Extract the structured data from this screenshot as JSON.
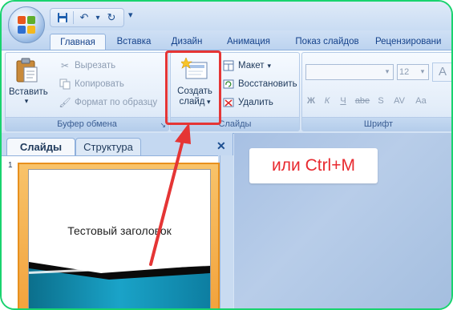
{
  "quick_access": {
    "items": [
      {
        "name": "save-icon",
        "glyph": "💾"
      },
      {
        "name": "undo-icon",
        "glyph": "↶"
      },
      {
        "name": "undo-dropdown-icon",
        "glyph": "▾"
      },
      {
        "name": "redo-icon",
        "glyph": "↻"
      },
      {
        "name": "customize-qat-icon",
        "glyph": "▾"
      }
    ]
  },
  "tabs": [
    "Главная",
    "Вставка",
    "Дизайн",
    "Анимация",
    "Показ слайдов",
    "Рецензировани"
  ],
  "active_tab": "Главная",
  "ribbon": {
    "clipboard": {
      "paste_label": "Вставить",
      "cut_label": "Вырезать",
      "copy_label": "Копировать",
      "format_painter_label": "Формат по образцу",
      "group_label": "Буфер обмена"
    },
    "slides": {
      "new_slide_line1": "Создать",
      "new_slide_line2": "слайд",
      "layout_label": "Макет",
      "reset_label": "Восстановить",
      "delete_label": "Удалить",
      "group_label": "Слайды"
    },
    "font": {
      "font_name_value": "",
      "font_size_value": "12",
      "bold": "Ж",
      "italic": "К",
      "underline": "Ч",
      "strikethrough": "abe",
      "shadow": "S",
      "spacing": "AV",
      "case": "Aa",
      "grow": "A",
      "group_label": "Шрифт"
    }
  },
  "side_panel": {
    "tab_slides": "Слайды",
    "tab_outline": "Структура",
    "close_glyph": "✕",
    "slide_number": "1",
    "slide_title": "Тестовый заголовок"
  },
  "annotation": {
    "text": "или Ctrl+M",
    "color": "#e8292f"
  },
  "colors": {
    "highlight_border": "#e53535",
    "accent_green_border": "#19d36e",
    "ribbon_text": "#1e395b"
  }
}
